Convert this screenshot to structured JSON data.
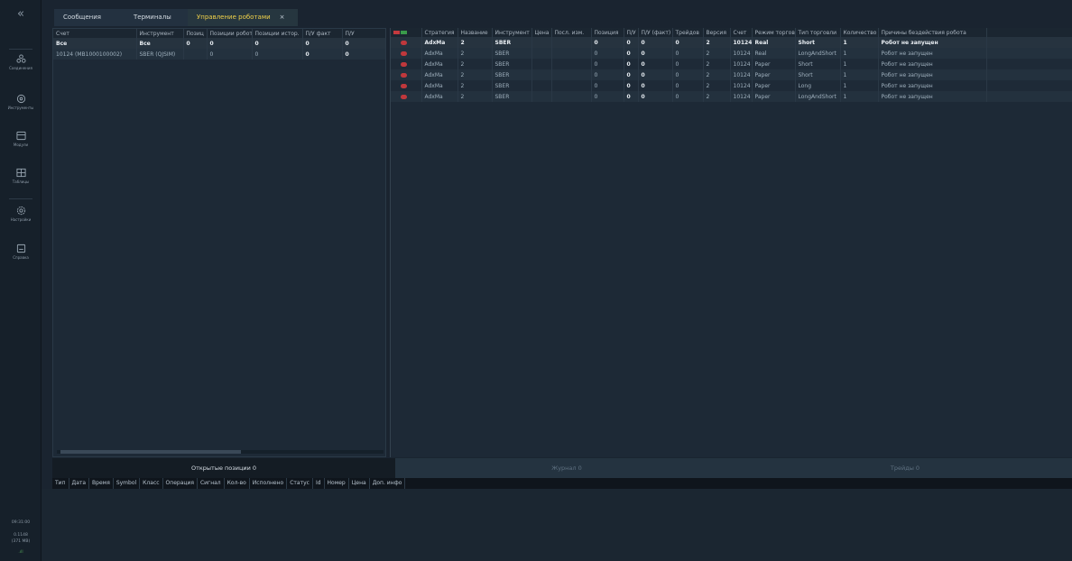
{
  "sidebar": {
    "collapse_glyph": "«",
    "items": [
      {
        "label": "Соединения",
        "icon": "connections-icon"
      },
      {
        "label": "Инструменты",
        "icon": "instruments-icon"
      },
      {
        "label": "Модули",
        "icon": "modules-icon"
      },
      {
        "label": "Таблицы",
        "icon": "tables-icon"
      },
      {
        "label": "Настройки",
        "icon": "settings-icon"
      },
      {
        "label": "Справка",
        "icon": "help-icon"
      }
    ],
    "status": {
      "time": "09:31:00",
      "load": "0.1148",
      "memory": "(371 MB)",
      "signal_glyph": ".ıll"
    }
  },
  "tabs": [
    {
      "label": "Сообщения"
    },
    {
      "label": "Терминалы"
    },
    {
      "label": "Управление роботами",
      "close": "×"
    }
  ],
  "left_table": {
    "columns": [
      "Счет",
      "Инструмент",
      "Позиц",
      "Позиции робот",
      "Позиции истор.",
      "П/У факт",
      "П/У"
    ],
    "rows": [
      [
        "Все",
        "Все",
        "0",
        "0",
        "0",
        "0",
        "0"
      ],
      [
        "10124 (MB1000100002)",
        "SBER (QJSIM)",
        "",
        "0",
        "0",
        "0",
        "0"
      ]
    ]
  },
  "right_table": {
    "columns": [
      "",
      "Стратегия",
      "Название",
      "Инструмент",
      "Цена",
      "Посл. изм.",
      "Позиция",
      "П/У",
      "П/У (факт)",
      "Трейдов",
      "Версия",
      "Счет",
      "Режим торгов",
      "Тип торговли",
      "Количество",
      "Причины бездействия робота"
    ],
    "rows": [
      [
        "",
        "AdxMa",
        "2",
        "SBER",
        "",
        "",
        "0",
        "0",
        "0",
        "0",
        "2",
        "10124",
        "Real",
        "Short",
        "1",
        "Робот не запущен"
      ],
      [
        "",
        "AdxMa",
        "2",
        "SBER",
        "",
        "",
        "0",
        "0",
        "0",
        "0",
        "2",
        "10124",
        "Real",
        "LongAndShort",
        "1",
        "Робот не запущен"
      ],
      [
        "",
        "AdxMa",
        "2",
        "SBER",
        "",
        "",
        "0",
        "0",
        "0",
        "0",
        "2",
        "10124",
        "Paper",
        "Short",
        "1",
        "Робот не запущен"
      ],
      [
        "",
        "AdxMa",
        "2",
        "SBER",
        "",
        "",
        "0",
        "0",
        "0",
        "0",
        "2",
        "10124",
        "Paper",
        "Short",
        "1",
        "Робот не запущен"
      ],
      [
        "",
        "AdxMa",
        "2",
        "SBER",
        "",
        "",
        "0",
        "0",
        "0",
        "0",
        "2",
        "10124",
        "Paper",
        "Long",
        "1",
        "Робот не запущен"
      ],
      [
        "",
        "AdxMa",
        "2",
        "SBER",
        "",
        "",
        "0",
        "0",
        "0",
        "0",
        "2",
        "10124",
        "Paper",
        "LongAndShort",
        "1",
        "Робот не запущен"
      ]
    ]
  },
  "bottom": {
    "tabs": [
      {
        "label": "Открытые позиции 0"
      },
      {
        "label": "Журнал 0"
      },
      {
        "label": "Трейды 0"
      }
    ],
    "columns": [
      "Тип",
      "Дата",
      "Время",
      "Symbol",
      "Класс",
      "Операция",
      "Сигнал",
      "Кол-во",
      "Исполнено",
      "Статус",
      "Id",
      "Номер",
      "Цена",
      "Доп. инфо"
    ]
  },
  "colors": {
    "active_tab_text": "#f0d14a",
    "stop_dot": "#c0383c",
    "header_red": "#c33a3e",
    "header_green": "#3a9a4a"
  }
}
